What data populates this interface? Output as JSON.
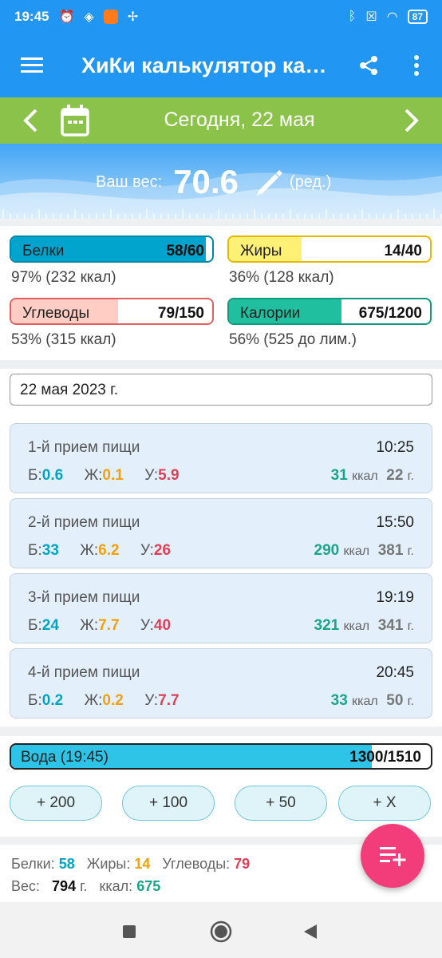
{
  "status": {
    "time": "19:45",
    "battery": "87"
  },
  "app": {
    "title": "ХиКи калькулятор ка…"
  },
  "date_nav": {
    "label": "Сегодня, 22 мая"
  },
  "weight": {
    "label": "Ваш вес:",
    "value": "70.6",
    "edit_label": "(ред.)"
  },
  "macros": [
    {
      "name": "Белки",
      "value": "58/60",
      "sub": "97% (232 ккал)",
      "fraction": 0.97,
      "fill": "#00a4cc",
      "border": "#0088a8"
    },
    {
      "name": "Жиры",
      "value": "14/40",
      "sub": "36% (128 ккал)",
      "fraction": 0.36,
      "fill": "#fff176",
      "border": "#e8b800"
    },
    {
      "name": "Углеводы",
      "value": "79/150",
      "sub": "53% (315 ккал)",
      "fraction": 0.53,
      "fill": "#ffcdc4",
      "border": "#e06060"
    },
    {
      "name": "Калории",
      "value": "675/1200",
      "sub": "56% (525 до лим.)",
      "fraction": 0.56,
      "fill": "#1fbf9f",
      "border": "#0f9a80"
    }
  ],
  "date_field": {
    "value": "22 мая 2023 г."
  },
  "meals": [
    {
      "name": "1-й прием пищи",
      "time": "10:25",
      "b_label": "Б:",
      "b": "0.6",
      "z_label": "Ж:",
      "z": "0.1",
      "u_label": "У:",
      "u": "5.9",
      "kcal": "31",
      "kcal_unit": "ккал",
      "grams": "22",
      "grams_unit": "г."
    },
    {
      "name": "2-й прием пищи",
      "time": "15:50",
      "b_label": "Б:",
      "b": "33",
      "z_label": "Ж:",
      "z": "6.2",
      "u_label": "У:",
      "u": "26",
      "kcal": "290",
      "kcal_unit": "ккал",
      "grams": "381",
      "grams_unit": "г."
    },
    {
      "name": "3-й прием пищи",
      "time": "19:19",
      "b_label": "Б:",
      "b": "24",
      "z_label": "Ж:",
      "z": "7.7",
      "u_label": "У:",
      "u": "40",
      "kcal": "321",
      "kcal_unit": "ккал",
      "grams": "341",
      "grams_unit": "г."
    },
    {
      "name": "4-й прием пищи",
      "time": "20:45",
      "b_label": "Б:",
      "b": "0.2",
      "z_label": "Ж:",
      "z": "0.2",
      "u_label": "У:",
      "u": "7.7",
      "kcal": "33",
      "kcal_unit": "ккал",
      "grams": "50",
      "grams_unit": "г."
    }
  ],
  "water": {
    "label": "Вода (19:45)",
    "value": "1300/1510",
    "fraction": 0.86,
    "buttons": [
      "+ 200",
      "+ 100",
      "+ 50",
      "+ X"
    ]
  },
  "summary": {
    "b_label": "Белки:",
    "b": "58",
    "z_label": "Жиры:",
    "z": "14",
    "u_label": "Углеводы:",
    "u": "79",
    "w_label": "Вес:",
    "w": "794",
    "w_unit": "г.",
    "k_label": "ккал:",
    "k": "675"
  },
  "colors": {
    "primary": "#2196f3",
    "date_bar": "#8bc34a",
    "fab": "#f23d7a",
    "protein": "#00a4c4",
    "fat": "#f0a010",
    "carbs": "#e04055",
    "kcal": "#1aa58a"
  }
}
